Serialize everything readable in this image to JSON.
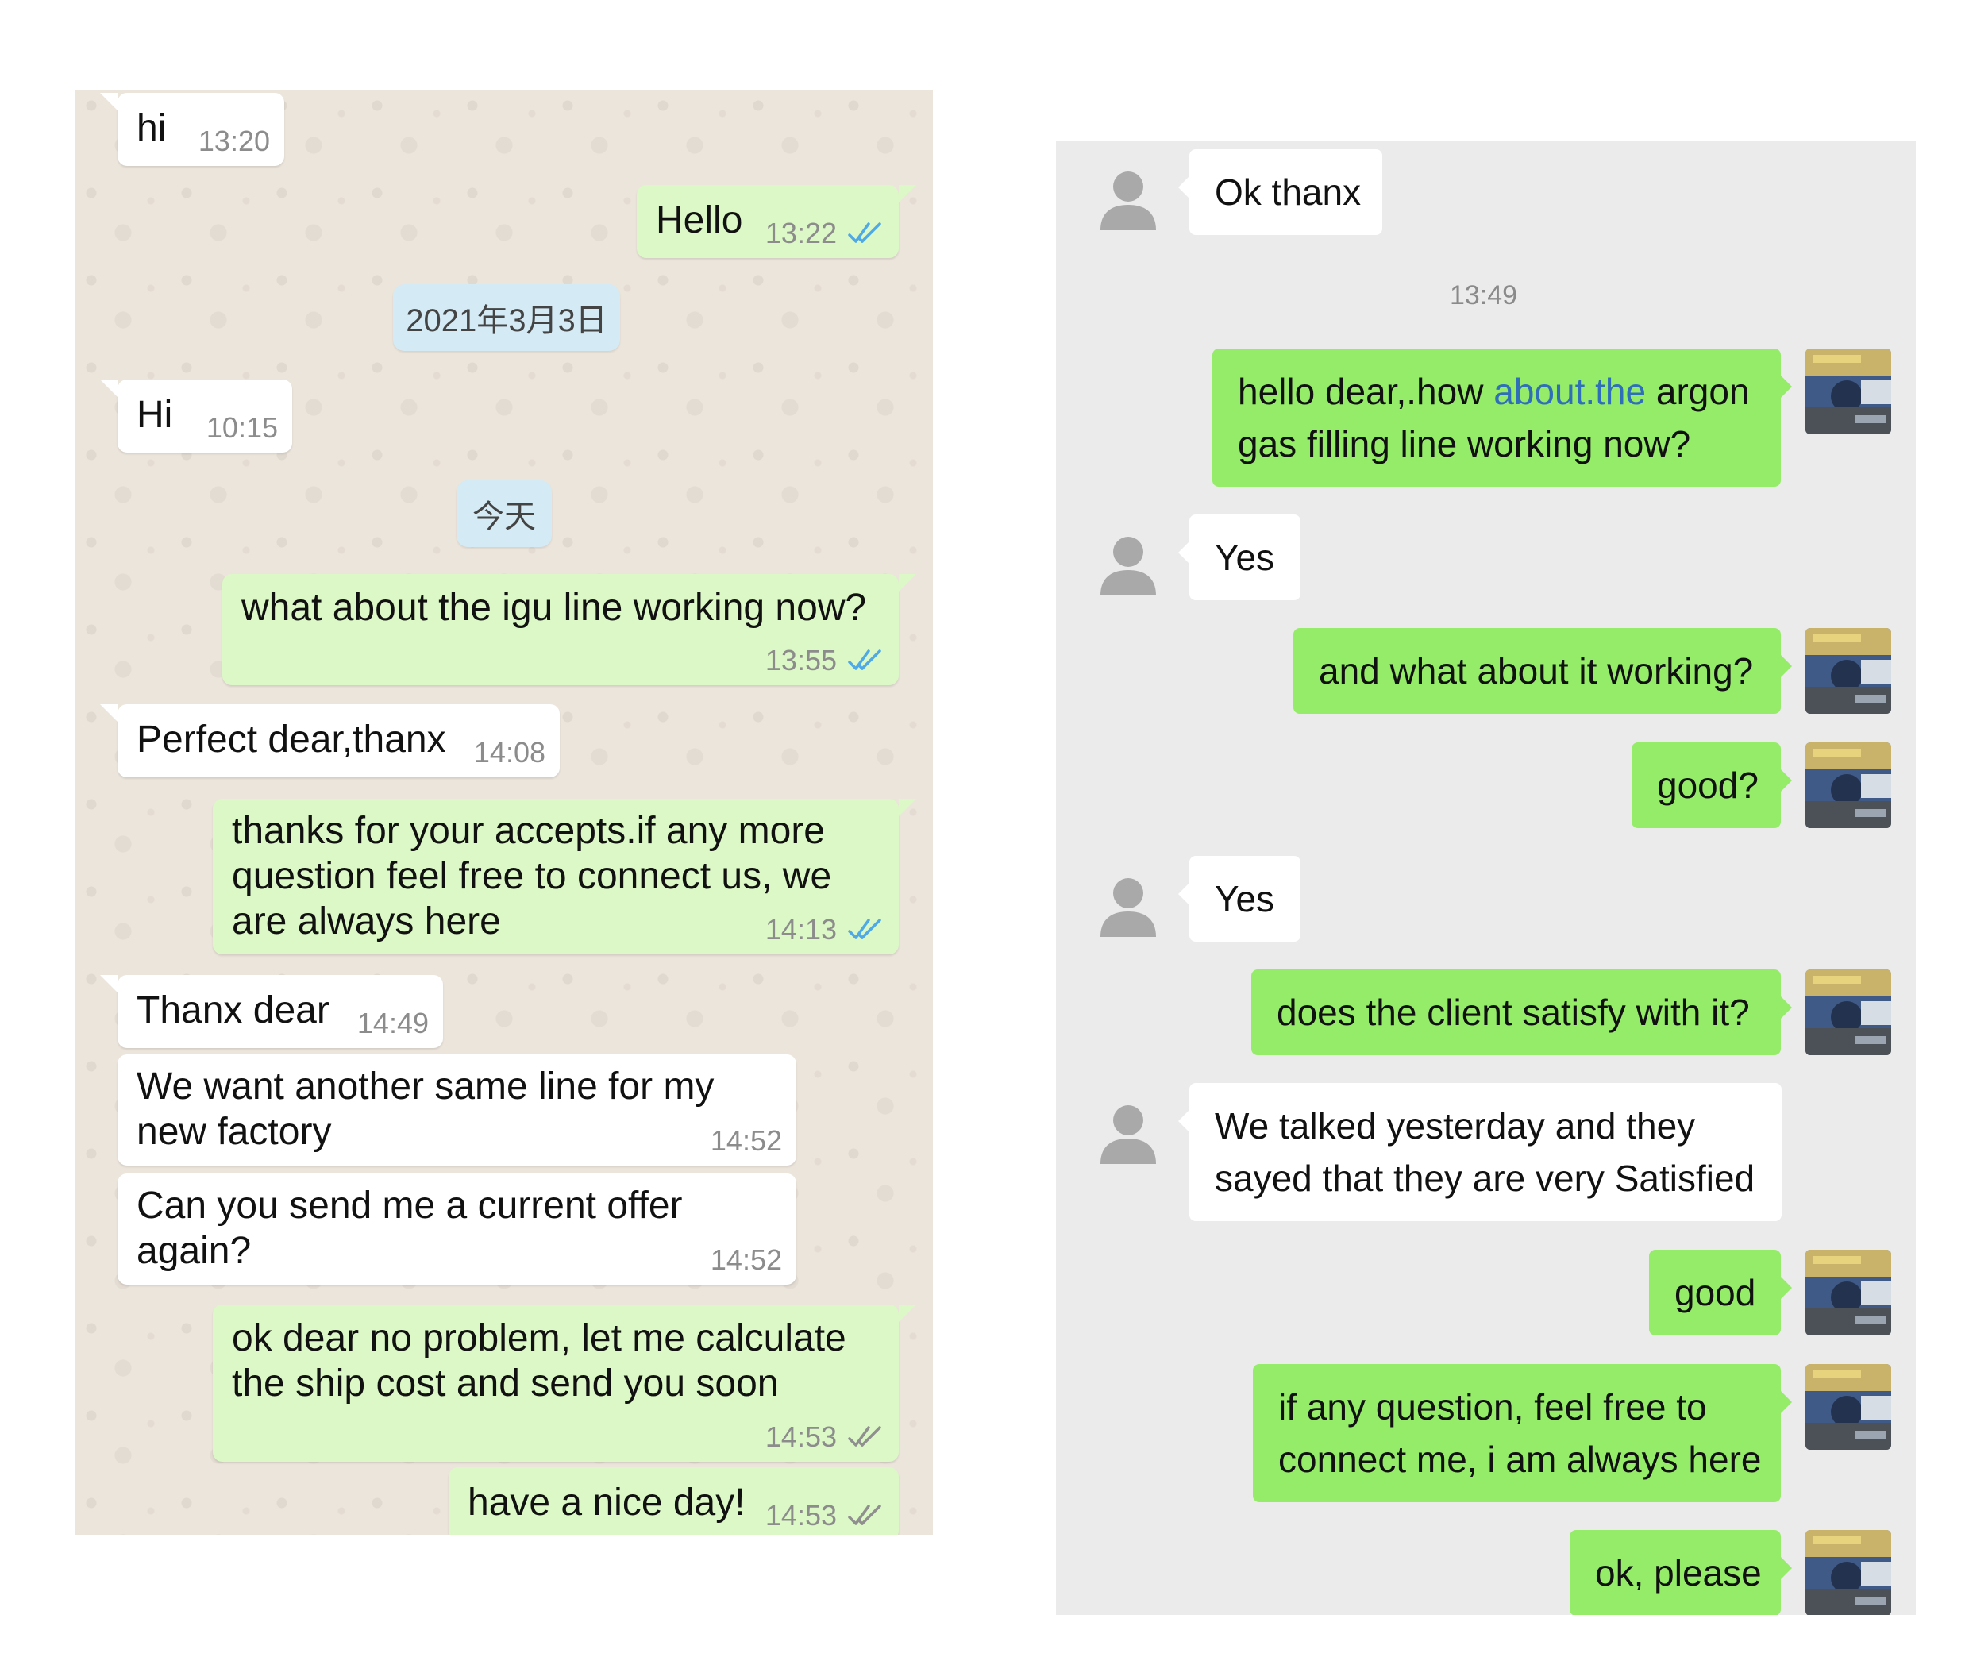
{
  "colors": {
    "whatsapp_background": "#ece5dc",
    "whatsapp_incoming_bubble": "#ffffff",
    "whatsapp_outgoing_bubble": "#dcf8c6",
    "whatsapp_date_pill": "#d4eaf4",
    "tick_read": "#4fa9e6",
    "tick_sent": "#8f8f8f",
    "wechat_background": "#ebebeb",
    "wechat_outgoing_bubble": "#95ec69",
    "wechat_link": "#2f6fb8"
  },
  "whatsapp": {
    "messages": [
      {
        "text": "hi",
        "time": "13:20",
        "direction": "incoming"
      },
      {
        "text": "Hello",
        "time": "13:22",
        "direction": "outgoing",
        "tick": "read"
      },
      {
        "date_separator": "2021年3月3日"
      },
      {
        "text": "Hi",
        "time": "10:15",
        "direction": "incoming"
      },
      {
        "date_separator": "今天"
      },
      {
        "lines": [
          "what about the igu line working now?"
        ],
        "time": "13:55",
        "direction": "outgoing",
        "tick": "read"
      },
      {
        "text": "Perfect dear,thanx",
        "time": "14:08",
        "direction": "incoming"
      },
      {
        "lines": [
          "thanks for your accepts.if  any more",
          "question feel free to connect us, we",
          "are always here"
        ],
        "time": "14:13",
        "direction": "outgoing",
        "tick": "read"
      },
      {
        "text": "Thanx dear",
        "time": "14:49",
        "direction": "incoming"
      },
      {
        "lines": [
          "We want another same line for my",
          "new factory"
        ],
        "time": "14:52",
        "direction": "incoming"
      },
      {
        "lines": [
          "Can you send me a current offer",
          "again?"
        ],
        "time": "14:52",
        "direction": "incoming"
      },
      {
        "lines": [
          "ok dear no problem, let me calculate",
          "the ship cost and send you soon"
        ],
        "time": "14:53",
        "direction": "outgoing",
        "tick": "sent"
      },
      {
        "text": "have a nice day!",
        "time": "14:53",
        "direction": "outgoing",
        "tick": "sent"
      }
    ]
  },
  "wechat": {
    "timestamp": "13:49",
    "messages": [
      {
        "lines": [
          "Ok thanx"
        ],
        "direction": "incoming"
      },
      {
        "line1_a": "hello dear,.how ",
        "line1_link": "about.the",
        "line1_b": " argon",
        "line2": "gas filling line working now?",
        "direction": "outgoing"
      },
      {
        "lines": [
          "Yes"
        ],
        "direction": "incoming"
      },
      {
        "lines": [
          "and what about it working?"
        ],
        "direction": "outgoing"
      },
      {
        "lines": [
          "good?"
        ],
        "direction": "outgoing"
      },
      {
        "lines": [
          "Yes"
        ],
        "direction": "incoming"
      },
      {
        "lines": [
          "does the client satisfy with it?"
        ],
        "direction": "outgoing"
      },
      {
        "lines": [
          "We talked yesterday and they",
          "sayed that they are very Satisfied"
        ],
        "direction": "incoming"
      },
      {
        "lines": [
          "good"
        ],
        "direction": "outgoing"
      },
      {
        "lines": [
          "if any question, feel free to",
          "connect me, i am always here"
        ],
        "direction": "outgoing"
      },
      {
        "lines": [
          "ok, please"
        ],
        "direction": "outgoing"
      }
    ]
  }
}
